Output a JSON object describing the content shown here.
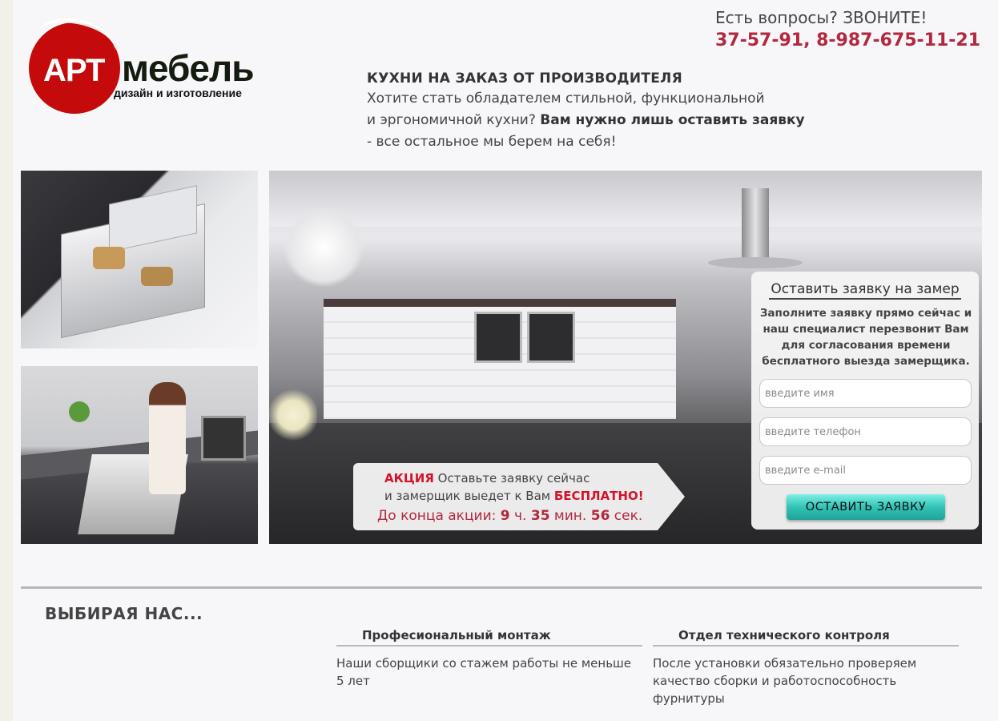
{
  "logo": {
    "brand_short": "АРТ",
    "brand_word": "мебель",
    "tagline": "дизайн и изготовление"
  },
  "contact": {
    "question": "Есть вопросы? ЗВОНИТЕ!",
    "phones": "37-57-91, 8-987-675-11-21"
  },
  "intro": {
    "heading": "КУХНИ НА ЗАКАЗ ОТ ПРОИЗВОДИТЕЛЯ",
    "line1": "Хотите стать обладателем стильной, функциональной",
    "line2_start": "и эргономичной кухни? ",
    "line2_bold": "Вам нужно лишь оставить заявку",
    "line3": "- все остальное мы берем на себя!"
  },
  "promo": {
    "label": "АКЦИЯ",
    "line1_rest": " Оставьте заявку сейчас",
    "line2_start": "и замерщик выедет к Вам ",
    "line2_free": "БЕСПЛАТНО!",
    "timer_prefix": "До конца акции: ",
    "hours": "9",
    "hours_unit": " ч. ",
    "minutes": "35",
    "minutes_unit": " мин. ",
    "seconds": "56",
    "seconds_unit": " сек."
  },
  "form": {
    "title": "Оставить заявку на замер",
    "description": "Заполните заявку прямо сейчас и наш специалист перезвонит Вам для согласования времени бесплатного выезда замерщика.",
    "name_placeholder": "введите имя",
    "phone_placeholder": "введите телефон",
    "email_placeholder": "введите e-mail",
    "submit_label": "ОСТАВИТЬ ЗАЯВКУ"
  },
  "why_us": {
    "heading": "ВЫБИРАЯ НАС...",
    "features": [
      {
        "title": "Професиональный монтаж",
        "text": "Наши сборщики со стажем работы не меньше 5 лет"
      },
      {
        "title": "Отдел технического контроля",
        "text": "После установки обязательно проверяем качество сборки и работоспособность фурнитуры"
      }
    ]
  },
  "colors": {
    "accent_red": "#c40a0a",
    "phone_red": "#b3283e",
    "button_teal": "#32c3b6"
  }
}
